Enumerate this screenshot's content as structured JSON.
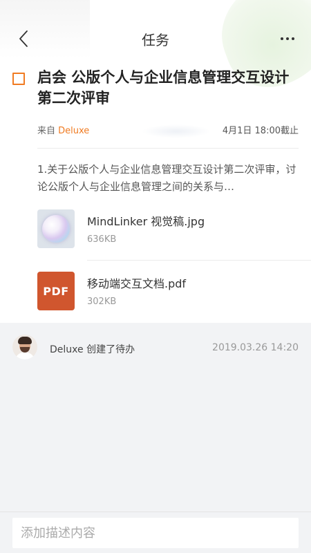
{
  "nav": {
    "title": "任务"
  },
  "task": {
    "title": "启会 公版个人与企业信息管理交互设计第二次评审",
    "source_prefix": "来自",
    "source_name": "Deluxe",
    "deadline": "4月1日 18:00截止",
    "description": "1.关于公版个人与企业信息管理交互设计第二次评审，讨论公版个人与企业信息管理之间的关系与…"
  },
  "attachments": [
    {
      "name": "MindLinker 视觉稿.jpg",
      "size": "636KB",
      "icon": "image-thumbnail"
    },
    {
      "name": "移动端交互文档.pdf",
      "size": "302KB",
      "icon": "pdf-icon",
      "badge": "PDF"
    }
  ],
  "activity": {
    "text": "Deluxe 创建了待办",
    "time": "2019.03.26 14:20"
  },
  "input": {
    "placeholder": "添加描述内容"
  },
  "colors": {
    "accent": "#f07b22",
    "pdf": "#d0562e",
    "background": "#f2f3f5"
  }
}
